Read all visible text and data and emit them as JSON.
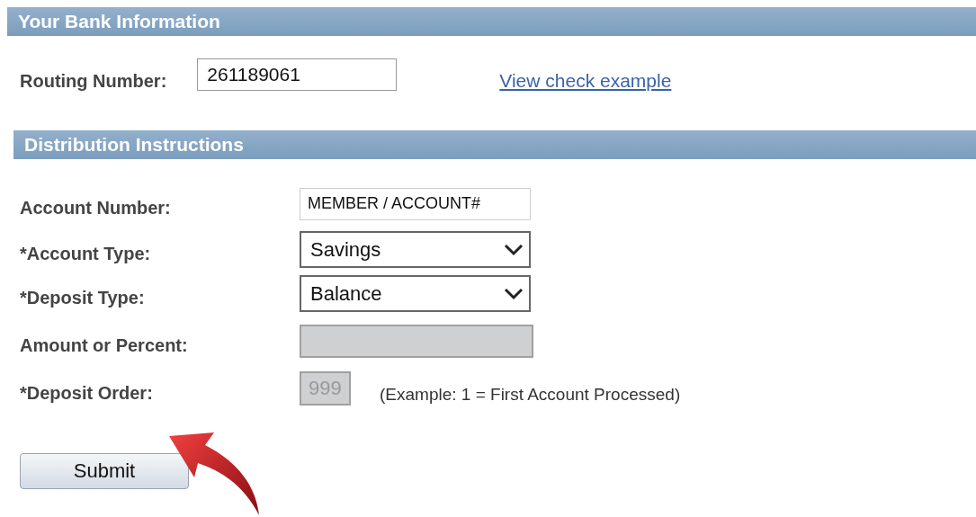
{
  "bank_info": {
    "title": "Your Bank Information",
    "routing": {
      "label": "Routing Number:",
      "value": "261189061"
    },
    "link": "View check example"
  },
  "distribution": {
    "title": "Distribution Instructions",
    "fields": [
      {
        "label": "Account Number:",
        "kind": "text",
        "value": "MEMBER / ACCOUNT#",
        "disabled": false
      },
      {
        "label": "*Account Type:",
        "kind": "select",
        "value": "Savings",
        "disabled": false
      },
      {
        "label": "*Deposit Type:",
        "kind": "select",
        "value": "Balance",
        "disabled": false
      },
      {
        "label": "Amount or Percent:",
        "kind": "text",
        "disabled": true
      },
      {
        "label": "*Deposit Order:",
        "kind": "short",
        "value": "999",
        "disabled": true,
        "note": "(Example: 1 = First Account Processed)"
      }
    ]
  },
  "submit_button": "Submit"
}
